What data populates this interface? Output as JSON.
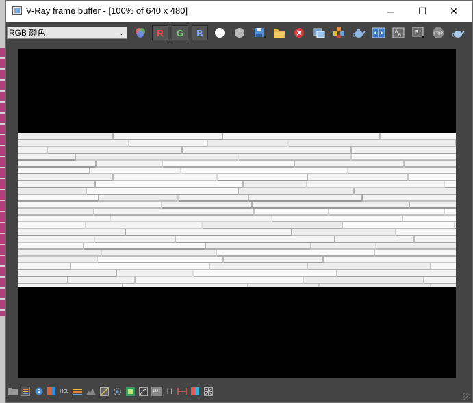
{
  "window": {
    "title": "V-Ray frame buffer - [100% of 640 x 480]",
    "controls": {
      "minimize": "─",
      "maximize": "☐",
      "close": "✕"
    }
  },
  "toolbar": {
    "channel_select": {
      "value": "RGB 颜色"
    },
    "channels": {
      "r": "R",
      "g": "G",
      "b": "B"
    },
    "channel_colors": {
      "r": "#ff4a4a",
      "g": "#7bd67b",
      "b": "#7aa8ff"
    },
    "stop_label": "STOP"
  },
  "render": {
    "background": "#000000",
    "wall_color": "#f4f4f4"
  },
  "statusbar": {
    "hsl_label": "HSL",
    "h_label": "H",
    "lut_label": "LUT"
  }
}
